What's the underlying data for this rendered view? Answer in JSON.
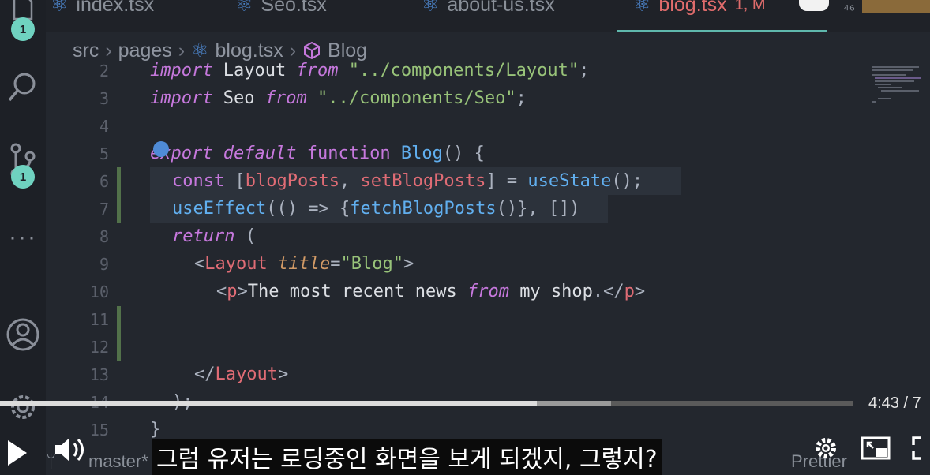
{
  "activity_bar": {
    "explorer_badge": "1",
    "scm_badge": "1",
    "more": "···"
  },
  "tabs": [
    {
      "label": "index.tsx"
    },
    {
      "label": "Seo.tsx"
    },
    {
      "label": "about-us.tsx"
    },
    {
      "label": "blog.tsx",
      "status": "1, M"
    }
  ],
  "tab_overflow": "⁴⁶",
  "breadcrumb": [
    "src",
    "pages",
    "blog.tsx",
    "Blog"
  ],
  "code_lines": [
    {
      "n": "2",
      "text": "import Layout from \"../components/Layout\";"
    },
    {
      "n": "3",
      "text": "import Seo from \"../components/Seo\";"
    },
    {
      "n": "4",
      "text": ""
    },
    {
      "n": "5",
      "text": "export default function Blog() {"
    },
    {
      "n": "6",
      "text": "const [blogPosts, setBlogPosts] = useState();"
    },
    {
      "n": "7",
      "text": "useEffect(() => {fetchBlogPosts()}, [])"
    },
    {
      "n": "8",
      "text": "return ("
    },
    {
      "n": "9",
      "text": "<Layout title=\"Blog\">"
    },
    {
      "n": "10",
      "text": "<p>The most recent news from my shop.</p>"
    },
    {
      "n": "11",
      "text": ""
    },
    {
      "n": "12",
      "text": ""
    },
    {
      "n": "13",
      "text": "</Layout>"
    },
    {
      "n": "14",
      "text": ");"
    },
    {
      "n": "15",
      "text": "}"
    }
  ],
  "video": {
    "time": "4:43 / 7",
    "progress": 0.63,
    "buffered": 0.717,
    "subtitle": "그럼 유저는 로딩중인 화면을 보게 되겠지, 그렇지?"
  },
  "status_bar": {
    "branch": "master*",
    "formatter": "Prettier"
  },
  "colors": {
    "editor_bg": "#23272e",
    "accent": "#5fb8ad",
    "badge": "#6fd2c0",
    "keyword": "#c678dd",
    "string": "#98c379",
    "function": "#61afef",
    "variable": "#e06c75"
  }
}
